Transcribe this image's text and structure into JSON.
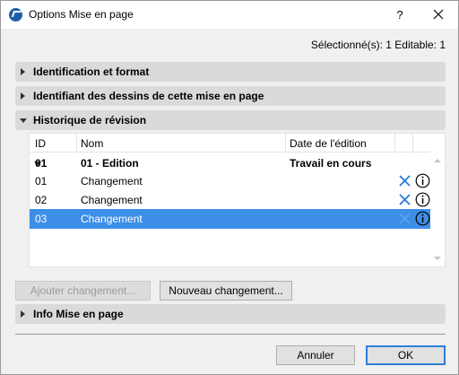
{
  "window": {
    "title": "Options Mise en page",
    "help_label": "?",
    "selection_info": "Sélectionné(s): 1 Editable: 1"
  },
  "sections": {
    "identification": "Identification et format",
    "drawing_id": "Identifiant des dessins de cette mise en page",
    "revision_history": "Historique de révision",
    "layout_info": "Info Mise en page"
  },
  "table": {
    "columns": {
      "id": "ID",
      "name": "Nom",
      "date": "Date de l'édition"
    },
    "group": {
      "id": "01",
      "name": "01 - Edition",
      "date": "Travail en cours"
    },
    "rows": [
      {
        "id": "01",
        "name": "Changement",
        "selected": false
      },
      {
        "id": "02",
        "name": "Changement",
        "selected": false
      },
      {
        "id": "03",
        "name": "Changement",
        "selected": true
      }
    ]
  },
  "buttons": {
    "add_change": "Ajouter changement...",
    "new_change": "Nouveau changement...",
    "cancel": "Annuler",
    "ok": "OK"
  },
  "colors": {
    "selection": "#3d8ee7",
    "delete_icon": "#2a7ad6",
    "section_bg": "#dadada"
  },
  "icons": {
    "app": "archicad-icon",
    "close": "close-icon",
    "delete": "delete-x-icon",
    "info": "info-icon"
  }
}
